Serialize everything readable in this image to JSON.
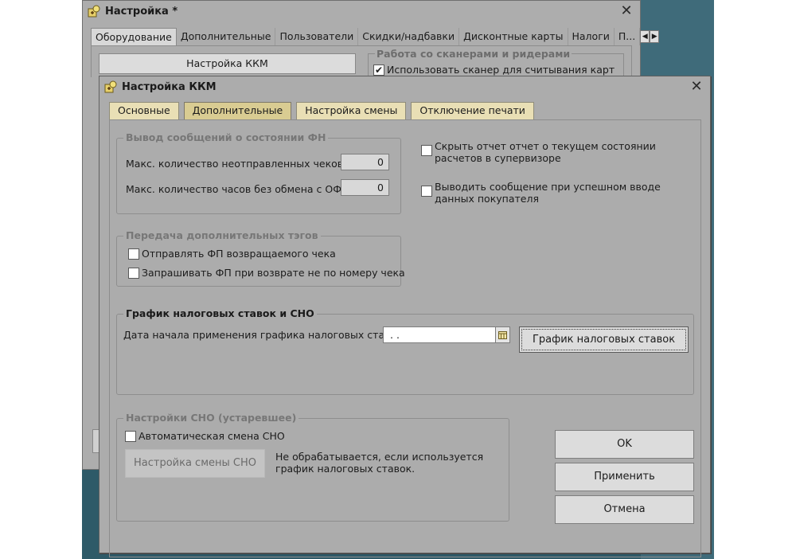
{
  "background_window": {
    "title": "Настройка *",
    "tabs": [
      "Оборудование",
      "Дополнительные",
      "Пользователи",
      "Скидки/надбавки",
      "Дисконтные карты",
      "Налоги",
      "П..."
    ],
    "kkm_button": "Настройка ККМ",
    "scanners_group_title": "Работа со сканерами и ридерами",
    "scanner_checkbox_label": "Использовать сканер для считывания карт",
    "scanner_checked": true
  },
  "dialog": {
    "title": "Настройка ККМ",
    "tabs": [
      {
        "label": "Основные"
      },
      {
        "label": "Дополнительные"
      },
      {
        "label": "Настройка смены"
      },
      {
        "label": "Отключение печати"
      }
    ],
    "fn_group": {
      "title": "Вывод сообщений о состоянии ФН",
      "max_unsent_label": "Макс. количество неотправленных чеков:",
      "max_unsent_value": "0",
      "max_hours_label": "Макс. количество часов без обмена с ОФД:",
      "max_hours_value": "0"
    },
    "tags_group": {
      "title": "Передача дополнительных тэгов",
      "send_fp_label": "Отправлять ФП возвращаемого чека",
      "send_fp_checked": false,
      "request_fp_label": "Запрашивать ФП при возврате не по номеру чека",
      "request_fp_checked": false
    },
    "right_options": {
      "hide_report_line1": "Скрыть отчет отчет о текущем состоянии",
      "hide_report_line2": "расчетов в супервизоре",
      "hide_report_checked": false,
      "show_message_line1": "Выводить сообщение при успешном вводе",
      "show_message_line2": "данных покупателя",
      "show_message_checked": false
    },
    "tax_group": {
      "title": "График налоговых ставок и СНО",
      "date_label": "Дата начала применения графика налоговых ставок:",
      "date_value": " .  .",
      "schedule_button": "График налоговых ставок"
    },
    "sno_group": {
      "title": "Настройки СНО (устаревшее)",
      "auto_change_label": "Автоматическая смена СНО",
      "auto_change_checked": false,
      "settings_button": "Настройка смены СНО",
      "note_line1": "Не обрабатывается, если используется",
      "note_line2": "график налоговых ставок."
    },
    "buttons": {
      "ok": "OK",
      "apply": "Применить",
      "cancel": "Отмена"
    }
  }
}
